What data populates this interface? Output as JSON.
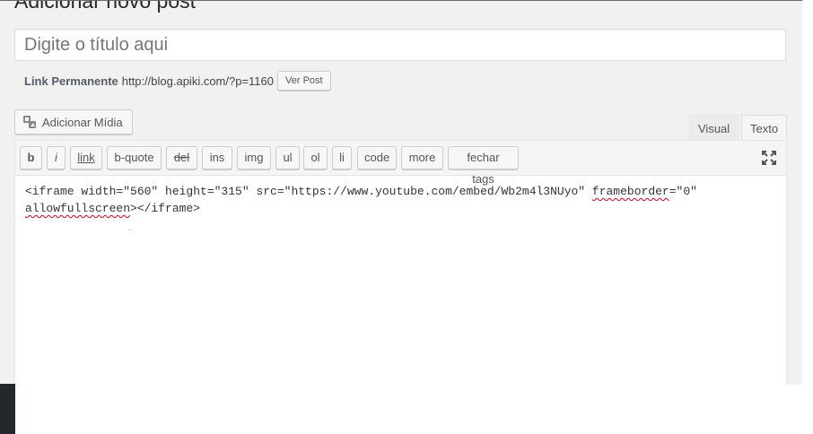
{
  "page": {
    "heading": "Adicionar novo post"
  },
  "title_field": {
    "placeholder": "Digite o título aqui",
    "value": ""
  },
  "permalink": {
    "label": "Link Permanente",
    "url": "http://blog.apiki.com/?p=1160",
    "view_button": "Ver Post"
  },
  "media": {
    "button_label": "Adicionar Mídia",
    "icon": "media-icon"
  },
  "editor_tabs": [
    {
      "label": "Visual",
      "active": false
    },
    {
      "label": "Texto",
      "active": true
    }
  ],
  "quicktags": [
    {
      "label": "b"
    },
    {
      "label": "i"
    },
    {
      "label": "link"
    },
    {
      "label": "b-quote"
    },
    {
      "label": "del"
    },
    {
      "label": "ins"
    },
    {
      "label": "img"
    },
    {
      "label": "ul"
    },
    {
      "label": "ol"
    },
    {
      "label": "li"
    },
    {
      "label": "code"
    },
    {
      "label": "more"
    },
    {
      "label": "fechar tags"
    }
  ],
  "editor": {
    "line1_start": "<iframe width=\"560\" height=\"315\" src=\"https://www.youtube.com/embed/Wb2m4l3NUyo\" ",
    "line1_word": "frameborder",
    "line1_end": "=\"0\"",
    "line2_word": "allowfullscreen",
    "line2_end": "></iframe>",
    "fullscreen_icon": "fullscreen-icon"
  },
  "colors": {
    "accent": "#0073aa",
    "background": "#f1f1f1",
    "spellcheck": "#d0021b"
  }
}
